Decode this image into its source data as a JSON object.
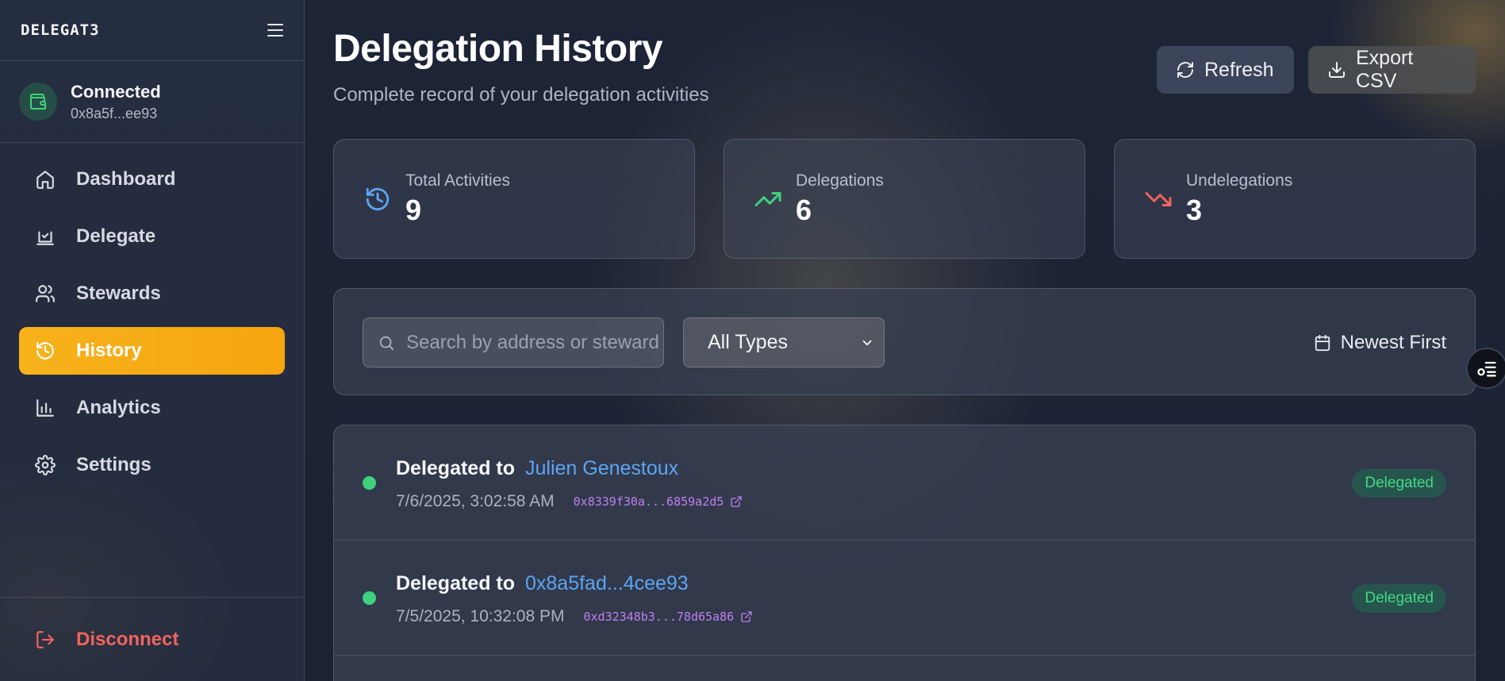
{
  "brand": "DELEGAT3",
  "wallet": {
    "status": "Connected",
    "address": "0x8a5f...ee93"
  },
  "nav": [
    {
      "label": "Dashboard",
      "icon": "home-icon"
    },
    {
      "label": "Delegate",
      "icon": "vote-icon"
    },
    {
      "label": "Stewards",
      "icon": "users-icon"
    },
    {
      "label": "History",
      "icon": "history-icon",
      "active": true
    },
    {
      "label": "Analytics",
      "icon": "bar-chart-icon"
    },
    {
      "label": "Settings",
      "icon": "gear-icon"
    }
  ],
  "disconnect_label": "Disconnect",
  "header": {
    "title": "Delegation History",
    "subtitle": "Complete record of your delegation activities",
    "refresh_label": "Refresh",
    "export_label": "Export CSV"
  },
  "stats": [
    {
      "label": "Total Activities",
      "value": "9",
      "icon": "history-icon",
      "color": "#5ea5f2"
    },
    {
      "label": "Delegations",
      "value": "6",
      "icon": "trending-up-icon",
      "color": "#3fd17d"
    },
    {
      "label": "Undelegations",
      "value": "3",
      "icon": "trending-down-icon",
      "color": "#f0645e"
    }
  ],
  "filters": {
    "search_placeholder": "Search by address or steward",
    "type_selected": "All Types",
    "sort_label": "Newest First"
  },
  "activities": [
    {
      "action": "Delegated to",
      "target": "Julien Genestoux",
      "time": "7/6/2025, 3:02:58 AM",
      "tx": "0x8339f30a...6859a2d5",
      "status": "Delegated"
    },
    {
      "action": "Delegated to",
      "target": "0x8a5fad...4cee93",
      "time": "7/5/2025, 10:32:08 PM",
      "tx": "0xd32348b3...78d65a86",
      "status": "Delegated"
    }
  ],
  "colors": {
    "accent": "#f5a50e",
    "link": "#5ea5f2",
    "hash": "#c27ff2",
    "success": "#3fd17d",
    "danger": "#f0645e"
  }
}
